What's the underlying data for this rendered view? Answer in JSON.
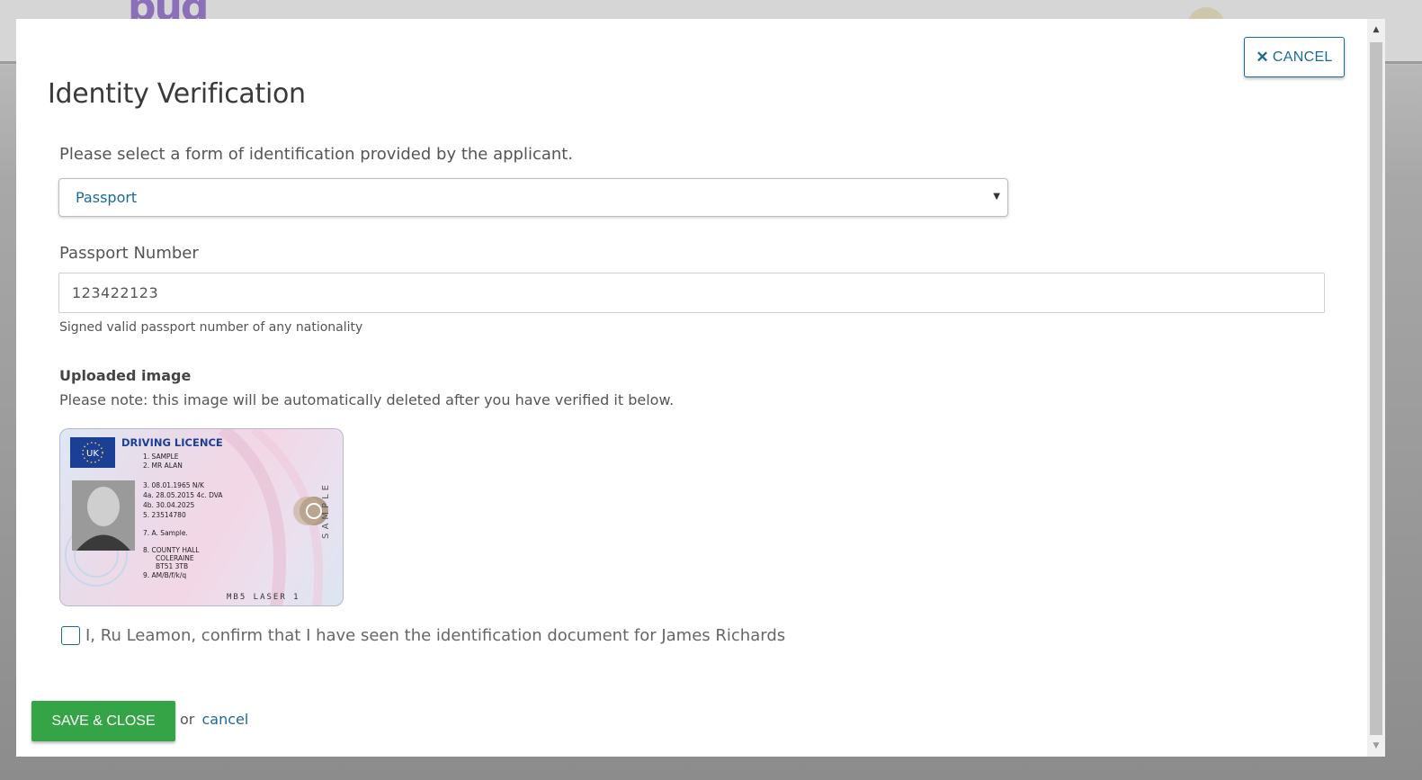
{
  "backdrop": {
    "logo_text": "bud"
  },
  "modal": {
    "cancel_top_label": "CANCEL",
    "title": "Identity Verification",
    "id_prompt": "Please select a form of identification provided by the applicant.",
    "id_select": {
      "selected": "Passport"
    },
    "number_field": {
      "label": "Passport Number",
      "value": "123422123",
      "hint": "Signed valid passport number of any nationality"
    },
    "upload": {
      "title": "Uploaded image",
      "note": "Please note: this image will be automatically deleted after you have verified it below.",
      "image": {
        "header": "DRIVING LICENCE",
        "country": "UK",
        "lines": [
          "1. SAMPLE",
          "2. MR ALAN",
          "3. 08.01.1965 N/K",
          "4a. 28.05.2015 4c. DVA",
          "4b. 30.04.2025",
          "5. 23514780",
          "7. A. Sample.",
          "8. COUNTY HALL",
          "COLERAINE",
          "BT51 3TB",
          "9. AM/B/f/k/q"
        ],
        "side_text": "SAMPLE",
        "footer": "MB5 LASER 1"
      }
    },
    "confirm_text": "I, Ru Leamon, confirm that I have seen the identification document for James Richards",
    "confirm_checked": false,
    "save_label": "SAVE & CLOSE",
    "or_text": "or",
    "cancel_link": "cancel"
  },
  "colors": {
    "accent": "#1b6a97",
    "save_button": "#35a447"
  },
  "icons": {
    "close": "close-icon",
    "caret": "caret-down-icon",
    "scroll_up": "scroll-up-arrow-icon",
    "scroll_down": "scroll-down-arrow-icon"
  }
}
